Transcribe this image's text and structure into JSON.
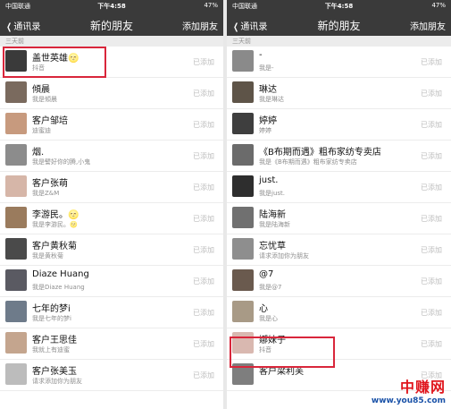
{
  "status_bar": {
    "carrier": "中国联通",
    "time": "下午4:58",
    "battery": "47%"
  },
  "nav": {
    "back_label": "通讯录",
    "title": "新的朋友",
    "add_label": "添加朋友"
  },
  "section_label": "三天前",
  "left_list": [
    {
      "name": "盖世英雄🌝",
      "sub": "抖音",
      "status": "已添加",
      "avatar_color": "#3a3a3a"
    },
    {
      "name": "傾晨",
      "sub": "我是傾晨",
      "status": "已添加",
      "avatar_color": "#7a6a5e"
    },
    {
      "name": "客户邹培",
      "sub": "迪蜜迪",
      "status": "已添加",
      "avatar_color": "#c79a7e"
    },
    {
      "name": "烟.",
      "sub": "我是譬好你的腾,小鬼",
      "status": "已添加",
      "avatar_color": "#8c8c8c"
    },
    {
      "name": "客户张萌",
      "sub": "我是Z&M",
      "status": "已添加",
      "avatar_color": "#d6b6a8"
    },
    {
      "name": "李游民。🌝",
      "sub": "我是李游民。🌝",
      "status": "已添加",
      "avatar_color": "#9a7b5d"
    },
    {
      "name": "客户黄秋菊",
      "sub": "我是黄秋菊",
      "status": "已添加",
      "avatar_color": "#4a4a4a"
    },
    {
      "name": "Diaze Huang",
      "sub": "我是Diaze Huang",
      "status": "已添加",
      "avatar_color": "#5a5a62"
    },
    {
      "name": "七年的梦i",
      "sub": "我是七年的梦i",
      "status": "已添加",
      "avatar_color": "#6e7b8a"
    },
    {
      "name": "客户王思佳",
      "sub": "我就上有迪蜜",
      "status": "已添加",
      "avatar_color": "#c4a58e"
    },
    {
      "name": "客户张美玉",
      "sub": "请求添加你为朋友",
      "status": "已添加",
      "avatar_color": "#bcbcbc"
    }
  ],
  "right_list": [
    {
      "name": "-",
      "sub": "我是-",
      "status": "已添加",
      "avatar_color": "#8a8a8a"
    },
    {
      "name": "琳达",
      "sub": "我是琳达",
      "status": "已添加",
      "avatar_color": "#5e5448"
    },
    {
      "name": "婷婷",
      "sub": "婷婷",
      "status": "已添加",
      "avatar_color": "#3e3e3e"
    },
    {
      "name": "《B布期而遇》粗布家纺专卖店",
      "sub": "我是《B布期而遇》粗布家纺专卖店",
      "status": "已添加",
      "avatar_color": "#6b6b6b"
    },
    {
      "name": "just.",
      "sub": "我是just.",
      "status": "已添加",
      "avatar_color": "#2e2e2e"
    },
    {
      "name": "陆海新",
      "sub": "我是陆海新",
      "status": "已添加",
      "avatar_color": "#707070"
    },
    {
      "name": "忘忧草",
      "sub": "请求添加你为朋友",
      "status": "已添加",
      "avatar_color": "#8e8e8e"
    },
    {
      "name": "@7",
      "sub": "我是@7",
      "status": "已添加",
      "avatar_color": "#6a5a4e"
    },
    {
      "name": "心",
      "sub": "我是心",
      "status": "已添加",
      "avatar_color": "#a89a86"
    },
    {
      "name": "娜妹子",
      "sub": "抖音",
      "status": "已添加",
      "avatar_color": "#d9b8b0"
    },
    {
      "name": "客户梁利芙",
      "sub": "",
      "status": "已添加",
      "avatar_color": "#7e7e7e"
    }
  ],
  "watermark": {
    "brand": "中赚网",
    "url": "www.you85.com"
  }
}
